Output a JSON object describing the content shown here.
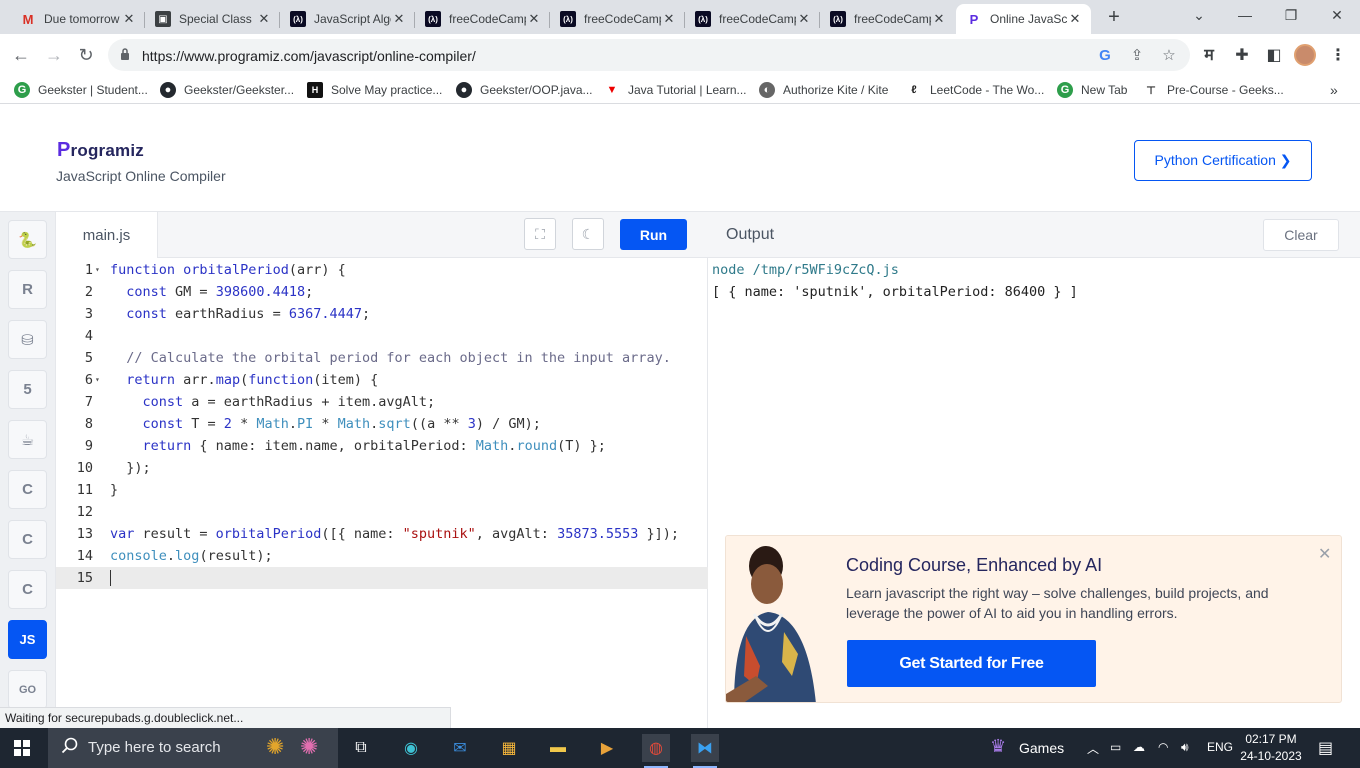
{
  "browser": {
    "tabs": [
      {
        "title": "Due tomorrow",
        "icon": "gmail-icon"
      },
      {
        "title": "Special Class",
        "icon": "special-class-icon"
      },
      {
        "title": "JavaScript Algorithms",
        "icon": "freecodecamp-icon"
      },
      {
        "title": "freeCodeCamp",
        "icon": "freecodecamp-icon"
      },
      {
        "title": "freeCodeCamp",
        "icon": "freecodecamp-icon"
      },
      {
        "title": "freeCodeCamp",
        "icon": "freecodecamp-icon"
      },
      {
        "title": "freeCodeCamp",
        "icon": "freecodecamp-icon"
      },
      {
        "title": "Online JavaScript Compiler",
        "icon": "programiz-icon"
      }
    ],
    "url": "https://www.programiz.com/javascript/online-compiler/",
    "bookmarks": [
      {
        "label": "Geekster | Student...",
        "icon": "geekster-icon"
      },
      {
        "label": "Geekster/Geekster...",
        "icon": "github-icon"
      },
      {
        "label": "Solve May practice...",
        "icon": "hackerrank-icon"
      },
      {
        "label": "Geekster/OOP.java...",
        "icon": "github-icon"
      },
      {
        "label": "Java Tutorial | Learn...",
        "icon": "javatpoint-icon"
      },
      {
        "label": "Authorize Kite / Kite",
        "icon": "kite-icon"
      },
      {
        "label": "LeetCode - The Wo...",
        "icon": "leetcode-icon"
      },
      {
        "label": "New Tab",
        "icon": "geekster-icon"
      },
      {
        "label": "Pre-Course - Geeks...",
        "icon": "precourse-icon"
      }
    ],
    "toolbar_extension_label": "म"
  },
  "site": {
    "logo": "rogramiz",
    "logo_initial": "P",
    "subtitle": "JavaScript Online Compiler",
    "cert_button": "Python Certification ❯"
  },
  "languages": [
    {
      "name": "Python",
      "glyph": "🐍"
    },
    {
      "name": "R",
      "glyph": "R"
    },
    {
      "name": "SQL",
      "glyph": "⛁"
    },
    {
      "name": "HTML",
      "glyph": "5"
    },
    {
      "name": "Java",
      "glyph": "☕"
    },
    {
      "name": "C",
      "glyph": "C"
    },
    {
      "name": "C++",
      "glyph": "C"
    },
    {
      "name": "C#",
      "glyph": "C"
    },
    {
      "name": "JavaScript",
      "glyph": "JS"
    },
    {
      "name": "Go",
      "glyph": "GO"
    }
  ],
  "editor": {
    "filename": "main.js",
    "run_label": "Run",
    "code_lines": [
      "function orbitalPeriod(arr) {",
      "  const GM = 398600.4418;",
      "  const earthRadius = 6367.4447;",
      "",
      "  // Calculate the orbital period for each object in the input array.",
      "  return arr.map(function(item) {",
      "    const a = earthRadius + item.avgAlt;",
      "    const T = 2 * Math.PI * Math.sqrt((a ** 3) / GM);",
      "    return { name: item.name, orbitalPeriod: Math.round(T) };",
      "  });",
      "}",
      "",
      "var result = orbitalPeriod([{ name: \"sputnik\", avgAlt: 35873.5553 }]);",
      "console.log(result);",
      ""
    ],
    "folded_lines": [
      1,
      6
    ],
    "current_line": 15
  },
  "output": {
    "title": "Output",
    "clear_label": "Clear",
    "lines": [
      "node /tmp/r5WFi9cZcQ.js",
      "[ { name: 'sputnik', orbitalPeriod: 86400 } ]"
    ]
  },
  "ad": {
    "title": "Coding Course, Enhanced by AI",
    "description": "Learn javascript the right way – solve challenges, build projects, and leverage the power of AI to aid you in handling errors.",
    "cta": "Get Started for Free"
  },
  "status_text": "Waiting for securepubads.g.doubleclick.net...",
  "taskbar": {
    "search_placeholder": "Type here to search",
    "games_label": "Games",
    "language": "ENG",
    "time": "02:17 PM",
    "date": "24-10-2023"
  },
  "colors": {
    "accent": "#0556f3",
    "brand": "#25265e",
    "keyword": "#2b33c6",
    "string": "#aa1111"
  }
}
